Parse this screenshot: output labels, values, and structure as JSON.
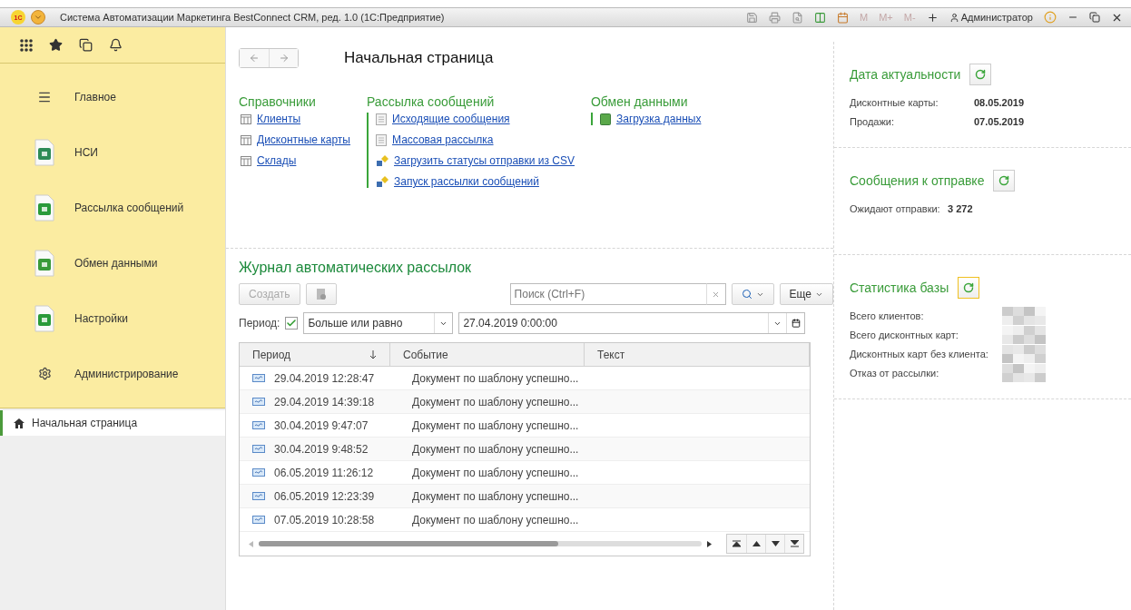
{
  "window": {
    "logo": "1С",
    "title": "Система Автоматизации Маркетинга BestConnect CRM, ред. 1.0  (1С:Предприятие)",
    "memory_buttons": [
      "M",
      "M+",
      "M-"
    ],
    "user": "Администратор"
  },
  "sidebar": {
    "items": [
      {
        "label": "Главное",
        "kind": "list"
      },
      {
        "label": "НСИ",
        "kind": "document"
      },
      {
        "label": "Рассылка сообщений",
        "kind": "document"
      },
      {
        "label": "Обмен данными",
        "kind": "document"
      },
      {
        "label": "Настройки",
        "kind": "document"
      },
      {
        "label": "Администрирование",
        "kind": "gear"
      }
    ],
    "open_windows": [
      {
        "label": "Начальная страница",
        "selected": true
      }
    ]
  },
  "page": {
    "title": "Начальная страница"
  },
  "sections": [
    {
      "title": "Справочники",
      "divider": false,
      "links": [
        {
          "label": "Клиенты",
          "kind": "catalog"
        },
        {
          "label": "Дисконтные карты",
          "kind": "catalog"
        },
        {
          "label": "Склады",
          "kind": "catalog"
        }
      ]
    },
    {
      "title": "Рассылка сообщений",
      "divider": true,
      "links": [
        {
          "label": "Исходящие сообщения",
          "kind": "document"
        },
        {
          "label": "Массовая рассылка",
          "kind": "document"
        },
        {
          "label": "Загрузить статусы отправки из CSV",
          "kind": "process"
        },
        {
          "label": "Запуск рассылки сообщений",
          "kind": "process"
        }
      ]
    },
    {
      "title": "Обмен данными",
      "divider": true,
      "links": [
        {
          "label": "Загрузка данных",
          "kind": "book"
        }
      ]
    }
  ],
  "journal": {
    "title": "Журнал автоматических рассылок",
    "create_button": {
      "label": "Создать",
      "disabled": true
    },
    "search": {
      "placeholder": "Поиск (Ctrl+F)"
    },
    "more_button": "Еще",
    "period": {
      "label": "Период:",
      "checked": true,
      "condition": "Больше или равно",
      "value": "27.04.2019  0:00:00"
    },
    "columns": [
      "Период",
      "Событие",
      "Текст"
    ],
    "rows": [
      {
        "period": "29.04.2019 12:28:47",
        "event": "Документ по шаблону успешно..."
      },
      {
        "period": "29.04.2019 14:39:18",
        "event": "Документ по шаблону успешно..."
      },
      {
        "period": "30.04.2019 9:47:07",
        "event": "Документ по шаблону успешно..."
      },
      {
        "period": "30.04.2019 9:48:52",
        "event": "Документ по шаблону успешно..."
      },
      {
        "period": "06.05.2019 11:26:12",
        "event": "Документ по шаблону успешно..."
      },
      {
        "period": "06.05.2019 12:23:39",
        "event": "Документ по шаблону успешно..."
      },
      {
        "period": "07.05.2019 10:28:58",
        "event": "Документ по шаблону успешно..."
      }
    ]
  },
  "panels": [
    {
      "title": "Дата актуальности",
      "focused": false,
      "stats": [
        {
          "label": "Дисконтные карты:",
          "value": "08.05.2019"
        },
        {
          "label": "Продажи:",
          "value": "07.05.2019"
        }
      ]
    },
    {
      "title": "Сообщения к отправке",
      "focused": false,
      "stats": [
        {
          "label": "Ожидают отправки:",
          "value": "3 272"
        }
      ]
    },
    {
      "title": "Статистика базы",
      "focused": true,
      "stats": [
        {
          "label": "Всего клиентов:",
          "redacted": true
        },
        {
          "label": "Всего дисконтных карт:",
          "redacted": true
        },
        {
          "label": "Дисконтных карт без клиента:",
          "redacted": true
        },
        {
          "label": "Отказ от рассылки:",
          "redacted": true
        }
      ]
    }
  ]
}
